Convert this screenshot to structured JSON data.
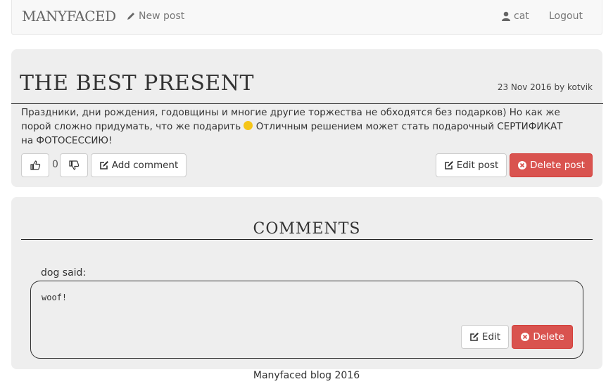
{
  "navbar": {
    "brand": "MANYFACED",
    "new_post_label": "New post",
    "user_label": "cat",
    "logout_label": "Logout"
  },
  "post": {
    "title": "THE BEST PRESENT",
    "meta": "23 Nov 2016 by kotvik",
    "body_part1": "Праздники, дни рождения, годовщины и многие другие торжества не обходятся без подарков) Но как же порой сложно придумать, что же подарить",
    "body_part2": "Отличным решением может стать подарочный СЕРТИФИКАТ на ФОТОСЕССИЮ!",
    "like_count": "0",
    "add_comment_label": "Add comment",
    "edit_label": "Edit post",
    "delete_label": "Delete post"
  },
  "comments": {
    "title": "COMMENTS",
    "items": [
      {
        "author_line": "dog said:",
        "text": "woof!",
        "edit_label": "Edit",
        "delete_label": "Delete"
      }
    ]
  },
  "footer": {
    "text": "Manyfaced blog 2016"
  },
  "icons": {
    "new_post": "pencil-icon",
    "user": "user-icon",
    "like": "thumbs-up-icon",
    "dislike": "thumbs-down-icon",
    "edit": "edit-icon",
    "delete": "times-circle-icon",
    "emoji": "smiley-icon"
  },
  "colors": {
    "danger": "#d9534f",
    "panel": "#eeeeee",
    "navbar": "#f8f8f8"
  }
}
